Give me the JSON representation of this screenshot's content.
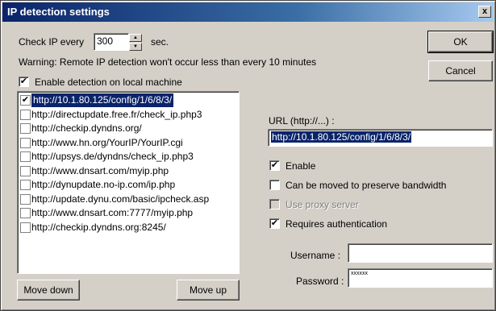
{
  "window": {
    "title": "IP detection settings",
    "close_label": "x"
  },
  "check_ip": {
    "prefix_label": "Check IP every",
    "value": "300",
    "suffix_label": "sec."
  },
  "warning_text": "Warning: Remote IP detection won't occur less than every 10 minutes",
  "local_detection": {
    "label": "Enable detection on local machine",
    "checked": true
  },
  "buttons": {
    "ok": "OK",
    "cancel": "Cancel",
    "move_down": "Move down",
    "move_up": "Move up"
  },
  "url_list": [
    {
      "url": "http://10.1.80.125/config/1/6/8/3/",
      "checked": true,
      "selected": true
    },
    {
      "url": "http://directupdate.free.fr/check_ip.php3",
      "checked": false,
      "selected": false
    },
    {
      "url": "http://checkip.dyndns.org/",
      "checked": false,
      "selected": false
    },
    {
      "url": "http://www.hn.org/YourIP/YourIP.cgi",
      "checked": false,
      "selected": false
    },
    {
      "url": "http://upsys.de/dyndns/check_ip.php3",
      "checked": false,
      "selected": false
    },
    {
      "url": "http://www.dnsart.com/myip.php",
      "checked": false,
      "selected": false
    },
    {
      "url": "http://dynupdate.no-ip.com/ip.php",
      "checked": false,
      "selected": false
    },
    {
      "url": "http://update.dynu.com/basic/ipcheck.asp",
      "checked": false,
      "selected": false
    },
    {
      "url": "http://www.dnsart.com:7777/myip.php",
      "checked": false,
      "selected": false
    },
    {
      "url": "http://checkip.dyndns.org:8245/",
      "checked": false,
      "selected": false
    }
  ],
  "details": {
    "url_label": "URL (http://...) :",
    "url_value": "http://10.1.80.125/config/1/6/8/3/",
    "enable_label": "Enable",
    "enable_checked": true,
    "bandwidth_label": "Can be moved to preserve bandwidth",
    "bandwidth_checked": false,
    "proxy_label": "Use proxy server",
    "proxy_checked": false,
    "auth_label": "Requires authentication",
    "auth_checked": true,
    "username_label": "Username :",
    "username_value": "",
    "password_label": "Password :",
    "password_value": "xxxxxx"
  },
  "colors": {
    "face": "#d4d0c8",
    "title_start": "#0a246a",
    "title_end": "#a6caf0",
    "selection": "#0a246a"
  }
}
